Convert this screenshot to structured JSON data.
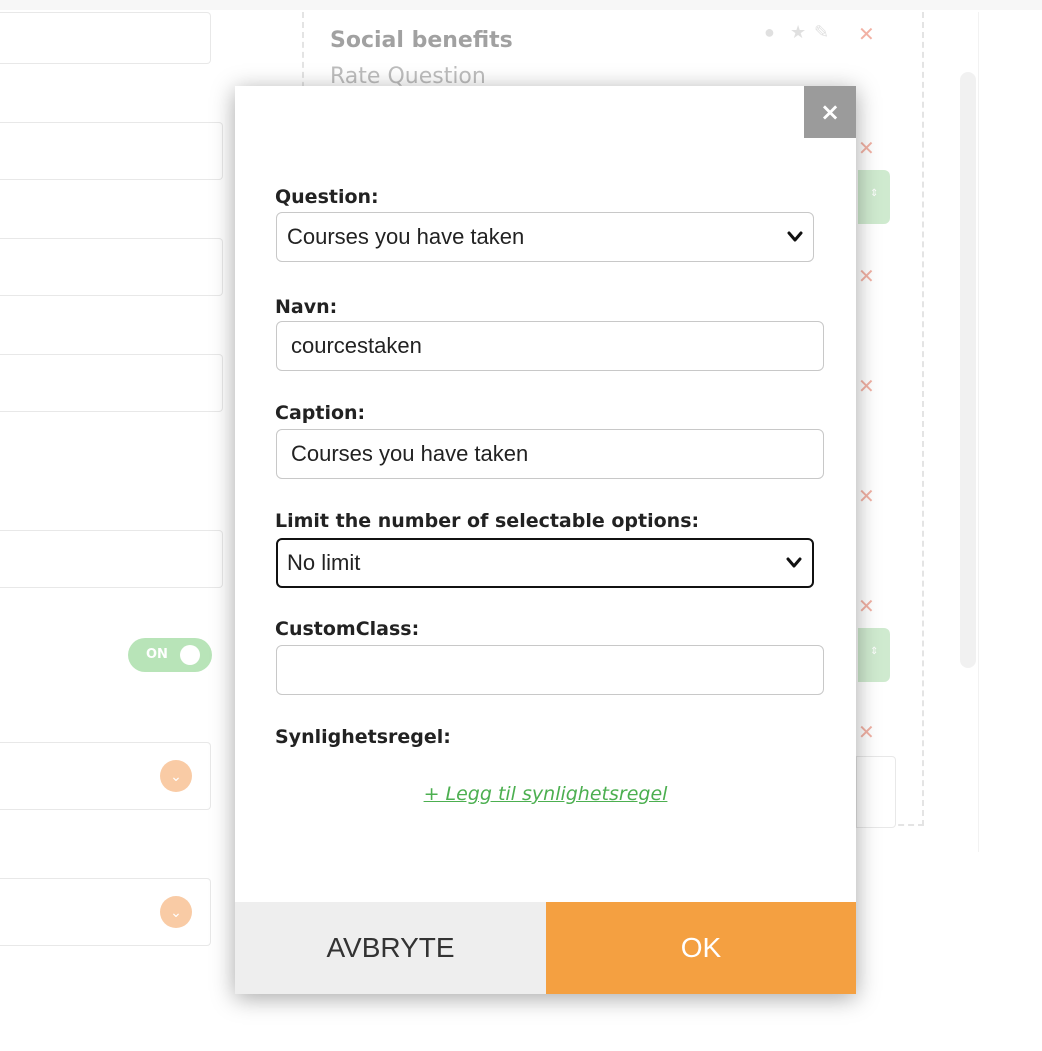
{
  "background": {
    "card_title": "Social benefits",
    "card_subtitle": "Rate Question",
    "toggle_label": "ON"
  },
  "modal": {
    "close_label": "×",
    "question": {
      "label": "Question:",
      "value": "Courses you have taken"
    },
    "navn": {
      "label": "Navn:",
      "value": "courcestaken"
    },
    "caption": {
      "label": "Caption:",
      "value": "Courses you have taken"
    },
    "limit": {
      "label": "Limit the number of selectable options:",
      "value": "No limit"
    },
    "custom_class": {
      "label": "CustomClass:",
      "value": ""
    },
    "visibility": {
      "label": "Synlighetsregel:",
      "add_link": "+ Legg til synlighetsregel"
    },
    "cancel_label": "AVBRYTE",
    "ok_label": "OK"
  },
  "colors": {
    "ok_button": "#f4a041",
    "cancel_button": "#eeeeee",
    "link": "#4caf50",
    "close_button": "#9b9b9b"
  },
  "icons": [
    "close-icon",
    "chevron-down-icon",
    "comment-icon",
    "star-icon",
    "pencil-icon",
    "delete-x-icon",
    "chevron-circle-icon"
  ]
}
